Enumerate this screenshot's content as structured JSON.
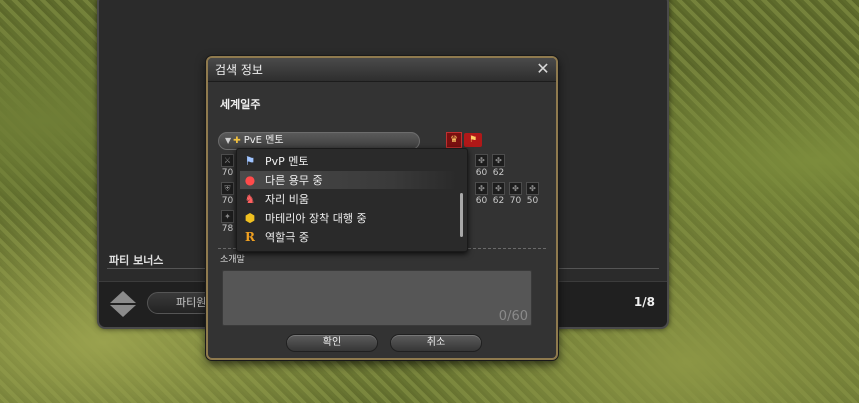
{
  "back_window": {
    "bonus_label": "파티 보너스",
    "party_button_label": "파티원",
    "party_count": "1/8"
  },
  "dialog": {
    "title": "검색 정보",
    "section_title": "세계일주",
    "status_select": {
      "value": "PvE 멘토"
    },
    "left_jobs": [
      {
        "level": "70"
      },
      {
        "level": "70"
      },
      {
        "level": "78"
      }
    ],
    "right_jobs_row1": [
      {
        "level": "60"
      },
      {
        "level": "62"
      }
    ],
    "right_jobs_row2": [
      {
        "level": "60"
      },
      {
        "level": "62"
      },
      {
        "level": "70"
      },
      {
        "level": "50"
      }
    ],
    "comment_label": "소개말",
    "comment_counter": "0/60",
    "ok_label": "확인",
    "cancel_label": "취소"
  },
  "dropdown": {
    "items": [
      {
        "label": "PvP 멘토",
        "icon": "pvp-mentor-icon",
        "color": "#9fc4ff"
      },
      {
        "label": "다른 용무 중",
        "icon": "busy-icon",
        "color": "#ff4a4a"
      },
      {
        "label": "자리 비움",
        "icon": "away-icon",
        "color": "#ff6060"
      },
      {
        "label": "마테리아 장착 대행 중",
        "icon": "materia-icon",
        "color": "#f0c020"
      },
      {
        "label": "역할극 중",
        "icon": "roleplay-icon",
        "color": "#f0a020"
      }
    ],
    "selected_index": 1
  },
  "colors": {
    "dialog_border": "#8f7a4e",
    "panel_bg": "#333333"
  }
}
